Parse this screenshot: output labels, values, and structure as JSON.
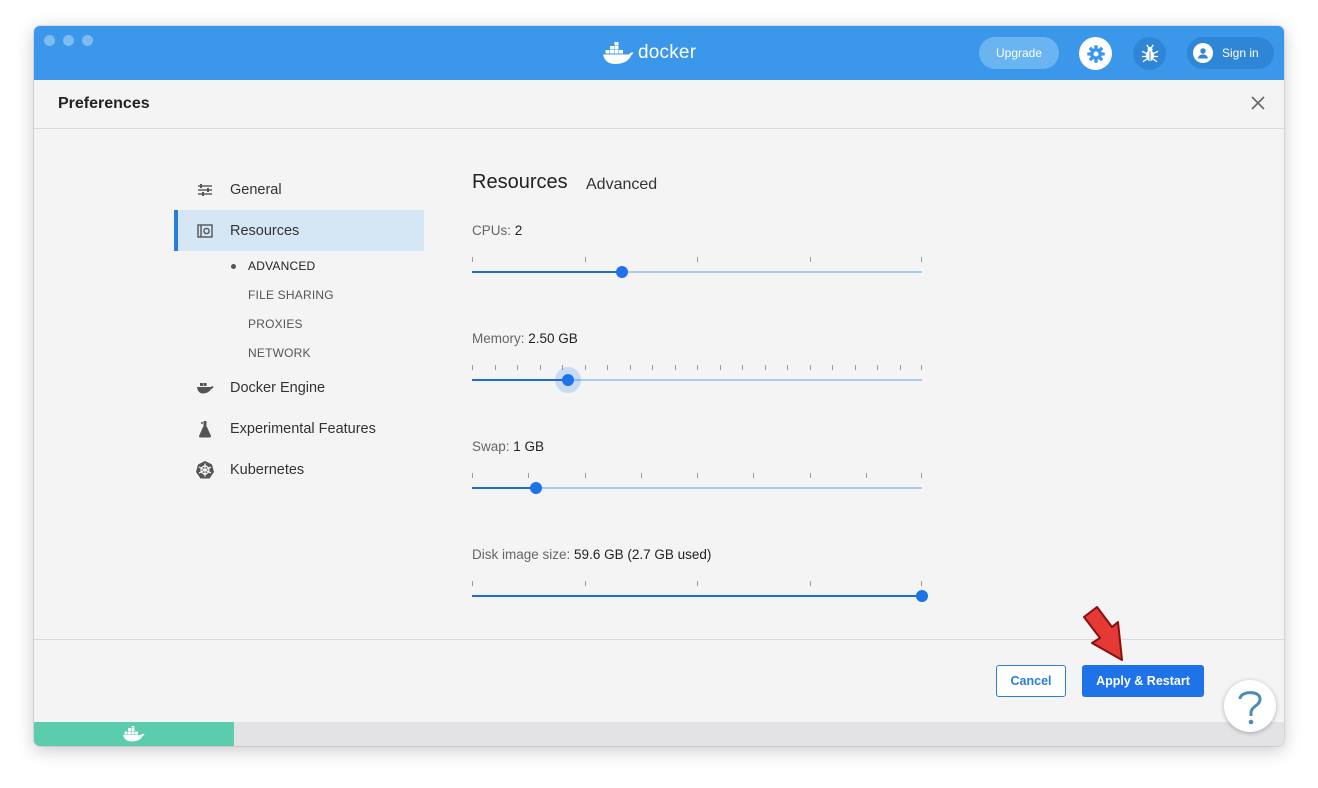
{
  "titlebar": {
    "app_name": "docker",
    "upgrade_label": "Upgrade",
    "signin_label": "Sign in"
  },
  "header": {
    "title": "Preferences"
  },
  "sidebar": {
    "items": [
      {
        "label": "General",
        "icon": "sliders-icon"
      },
      {
        "label": "Resources",
        "icon": "resources-icon",
        "active": true
      },
      {
        "label": "Docker Engine",
        "icon": "whale-icon"
      },
      {
        "label": "Experimental Features",
        "icon": "flask-icon"
      },
      {
        "label": "Kubernetes",
        "icon": "kubernetes-icon"
      }
    ],
    "subitems": [
      {
        "label": "ADVANCED",
        "active": true
      },
      {
        "label": "FILE SHARING"
      },
      {
        "label": "PROXIES"
      },
      {
        "label": "NETWORK"
      }
    ]
  },
  "main": {
    "title": "Resources",
    "tab": "Advanced",
    "resources": [
      {
        "label": "CPUs:",
        "value": "2",
        "position": 0.333,
        "ticks": 4
      },
      {
        "label": "Memory:",
        "value": "2.50 GB",
        "position": 0.213,
        "ticks": 20
      },
      {
        "label": "Swap:",
        "value": "1 GB",
        "position": 0.143,
        "ticks": 8
      },
      {
        "label": "Disk image size:",
        "value": "59.6 GB (2.7 GB used)",
        "position": 1.0,
        "ticks": 4
      }
    ]
  },
  "footer": {
    "cancel_label": "Cancel",
    "apply_label": "Apply & Restart"
  },
  "colors": {
    "titlebar": "#3a97ea",
    "accent": "#1e73e8",
    "status_green": "#5bcdae",
    "arrow": "#e53935"
  }
}
